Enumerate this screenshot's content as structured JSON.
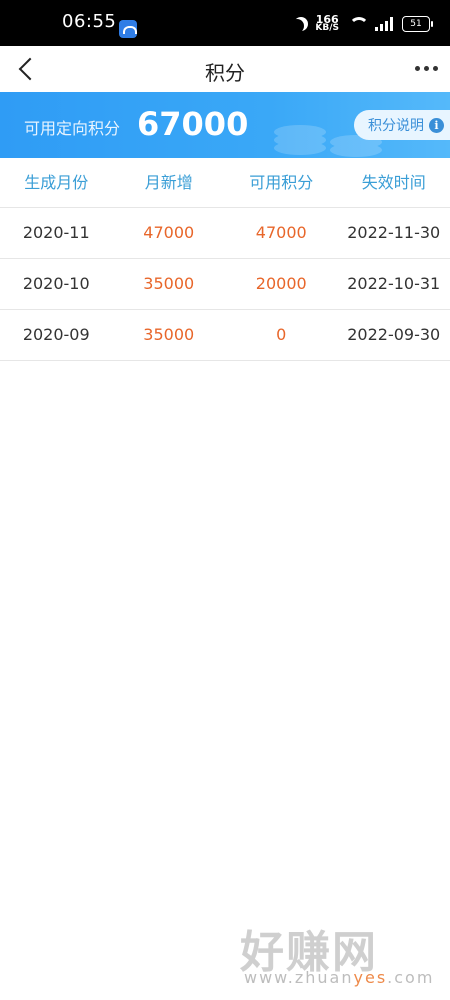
{
  "status_bar": {
    "time": "06:55",
    "speed_value": "166",
    "speed_unit": "KB/S",
    "battery": "51"
  },
  "header": {
    "title": "积分"
  },
  "banner": {
    "label": "可用定向积分",
    "value": "67000",
    "explain_label": "积分说明",
    "info_glyph": "i"
  },
  "table": {
    "headers": [
      "生成月份",
      "月新增",
      "可用积分",
      "失效时间"
    ],
    "rows": [
      {
        "month": "2020-11",
        "added": "47000",
        "available": "47000",
        "expires": "2022-11-30"
      },
      {
        "month": "2020-10",
        "added": "35000",
        "available": "20000",
        "expires": "2022-10-31"
      },
      {
        "month": "2020-09",
        "added": "35000",
        "available": "0",
        "expires": "2022-09-30"
      }
    ]
  },
  "watermark": {
    "brand": "好赚网",
    "url_prefix": "www.zhuan",
    "url_highlight": "yes",
    "url_suffix": ".com"
  },
  "colors": {
    "banner": "#3aa8f7",
    "header_text": "#3a9ed6",
    "value_orange": "#e8662a"
  }
}
